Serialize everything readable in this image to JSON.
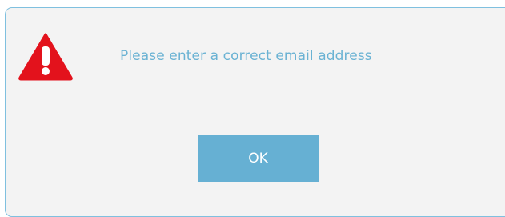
{
  "dialog": {
    "message": "Please enter a correct email address",
    "icon": "warning-icon",
    "ok_label": "OK"
  },
  "colors": {
    "background": "#f3f3f3",
    "border": "#7fc0df",
    "message_text": "#6ab2d3",
    "button_bg": "#66b0d3",
    "button_text": "#ffffff",
    "warning_red": "#e3121c"
  }
}
